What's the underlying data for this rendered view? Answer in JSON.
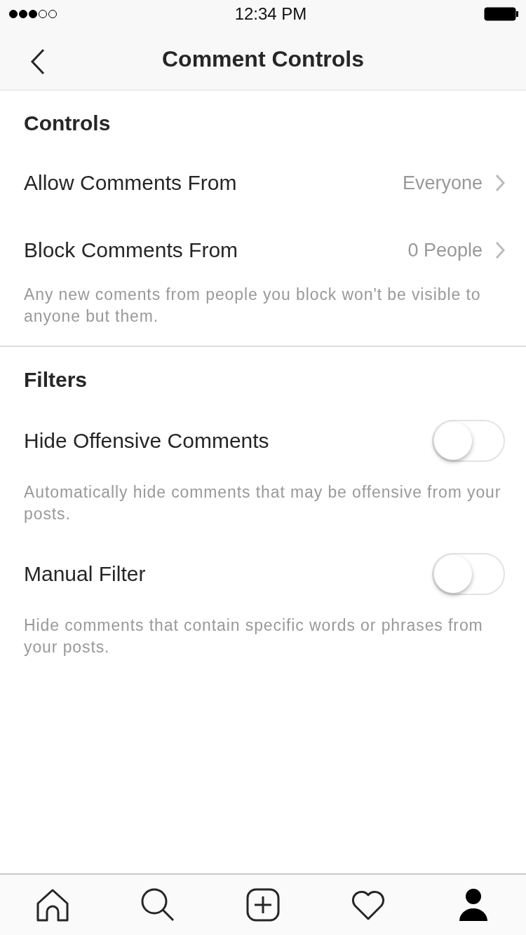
{
  "status_bar": {
    "time": "12:34 PM"
  },
  "nav": {
    "title": "Comment Controls"
  },
  "sections": [
    {
      "title": "Controls",
      "items": [
        {
          "kind": "link",
          "label": "Allow Comments From",
          "value": "Everyone"
        },
        {
          "kind": "link",
          "label": "Block Comments From",
          "value": "0 People",
          "note": "Any new coments from people you block won't be visible to anyone but them."
        }
      ]
    },
    {
      "title": "Filters",
      "items": [
        {
          "kind": "toggle",
          "label": "Hide Offensive Comments",
          "on": false,
          "note": "Automatically hide comments that may be offensive from your posts."
        },
        {
          "kind": "toggle",
          "label": "Manual Filter",
          "on": false,
          "note": "Hide comments that contain specific words or phrases from your posts."
        }
      ]
    }
  ],
  "tab_bar": [
    {
      "kind": "home",
      "selected": false
    },
    {
      "kind": "search",
      "selected": false
    },
    {
      "kind": "add",
      "selected": false
    },
    {
      "kind": "heart",
      "selected": false
    },
    {
      "kind": "profile",
      "selected": true
    }
  ]
}
